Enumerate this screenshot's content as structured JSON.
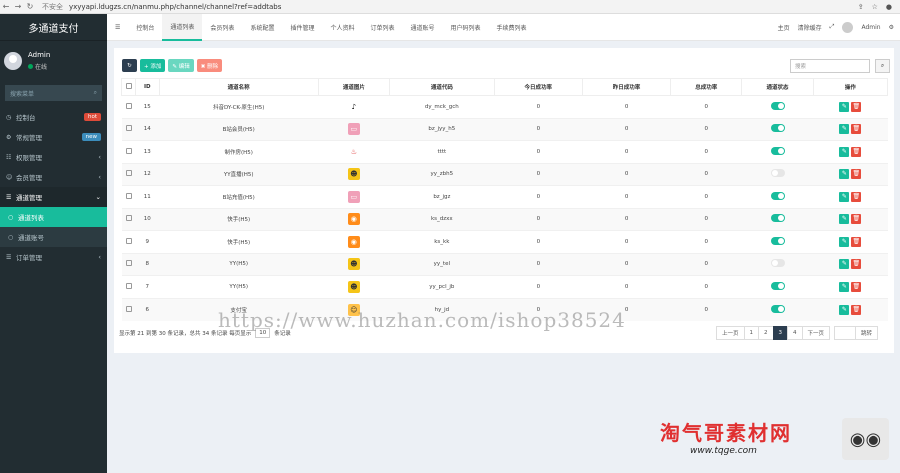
{
  "browser": {
    "security": "不安全",
    "url": "yxyyapi.ldugzs.cn/nanmu.php/channel/channel?ref=addtabs"
  },
  "sidebar": {
    "title": "多通道支付",
    "user": "Admin",
    "status": "在线",
    "search_placeholder": "搜索菜单",
    "items": [
      {
        "label": "控制台",
        "badge": "hot",
        "badge_color": "#dd4b39"
      },
      {
        "label": "常规管理",
        "badge": "new",
        "badge_color": "#3c8dbc"
      },
      {
        "label": "权限管理"
      },
      {
        "label": "会员管理"
      },
      {
        "label": "通道管理"
      }
    ],
    "sub": [
      {
        "label": "通道列表"
      },
      {
        "label": "通道账号"
      }
    ],
    "tail": [
      {
        "label": "订单管理"
      }
    ]
  },
  "topbar": {
    "tabs": [
      "控制台",
      "通道列表",
      "会员列表",
      "系统配置",
      "插件管理",
      "个人资料",
      "订单列表",
      "通道账号",
      "用户码列表",
      "手续费列表"
    ],
    "right": [
      "主页",
      "清除缓存",
      "Admin"
    ]
  },
  "toolbar": {
    "add": "+ 添加",
    "edit": "✎ 编辑",
    "del": "✖ 删除",
    "search_placeholder": "搜索"
  },
  "table": {
    "headers": [
      "",
      "ID",
      "通道名称",
      "通道图片",
      "通道代码",
      "今日成功率",
      "昨日成功率",
      "总成功率",
      "通道状态",
      "操作"
    ],
    "rows": [
      {
        "id": "15",
        "name": "抖音DY-CK-原生(H5)",
        "code": "dy_mck_gch",
        "icon": "♪",
        "icon_bg": "#ffffff",
        "icon_fg": "#000",
        "today": "0",
        "yest": "0",
        "total": "0",
        "on": true
      },
      {
        "id": "14",
        "name": "B站会员(H5)",
        "code": "bz_jyy_h5",
        "icon": "▭",
        "icon_bg": "#f0a0b8",
        "icon_fg": "#fff",
        "today": "0",
        "yest": "0",
        "total": "0",
        "on": true
      },
      {
        "id": "13",
        "name": "制作房(H5)",
        "code": "tttt",
        "icon": "♨",
        "icon_bg": "#ffffff",
        "icon_fg": "#e04040",
        "today": "0",
        "yest": "0",
        "total": "0",
        "on": true
      },
      {
        "id": "12",
        "name": "YY直播(H5)",
        "code": "yy_zbh5",
        "icon": "☻",
        "icon_bg": "#f5c518",
        "icon_fg": "#333",
        "today": "0",
        "yest": "0",
        "total": "0",
        "on": false
      },
      {
        "id": "11",
        "name": "B站充值(H5)",
        "code": "bz_jgz",
        "icon": "▭",
        "icon_bg": "#f0a0b8",
        "icon_fg": "#fff",
        "today": "0",
        "yest": "0",
        "total": "0",
        "on": true
      },
      {
        "id": "10",
        "name": "快手(H5)",
        "code": "ks_dzxx",
        "icon": "◉",
        "icon_bg": "#ff8c1a",
        "icon_fg": "#fff",
        "today": "0",
        "yest": "0",
        "total": "0",
        "on": true
      },
      {
        "id": "9",
        "name": "快手(H5)",
        "code": "ks_kk",
        "icon": "◉",
        "icon_bg": "#ff8c1a",
        "icon_fg": "#fff",
        "today": "0",
        "yest": "0",
        "total": "0",
        "on": true
      },
      {
        "id": "8",
        "name": "YY(H5)",
        "code": "yy_tel",
        "icon": "☻",
        "icon_bg": "#f5c518",
        "icon_fg": "#333",
        "today": "0",
        "yest": "0",
        "total": "0",
        "on": false
      },
      {
        "id": "7",
        "name": "YY(H5)",
        "code": "yy_pcl_jb",
        "icon": "☻",
        "icon_bg": "#f5c518",
        "icon_fg": "#333",
        "today": "0",
        "yest": "0",
        "total": "0",
        "on": true
      },
      {
        "id": "6",
        "name": "支付宝",
        "code": "hy_jd",
        "icon": "☺",
        "icon_bg": "#ffc24a",
        "icon_fg": "#333",
        "today": "0",
        "yest": "0",
        "total": "0",
        "on": true
      }
    ]
  },
  "footer": {
    "text1": "显示第 21 到第 30 条记录，总共 34 条记录 每页显示",
    "per_page": "10",
    "text2": "条记录"
  },
  "pager": {
    "prev": "上一页",
    "pages": [
      "1",
      "2",
      "3",
      "4"
    ],
    "active": "3",
    "next": "下一页",
    "jump": "跳转"
  },
  "watermark": "https://www.huzhan.com/ishop38524",
  "brand": {
    "name": "淘气哥素材网",
    "url": "www.tqge.com"
  }
}
